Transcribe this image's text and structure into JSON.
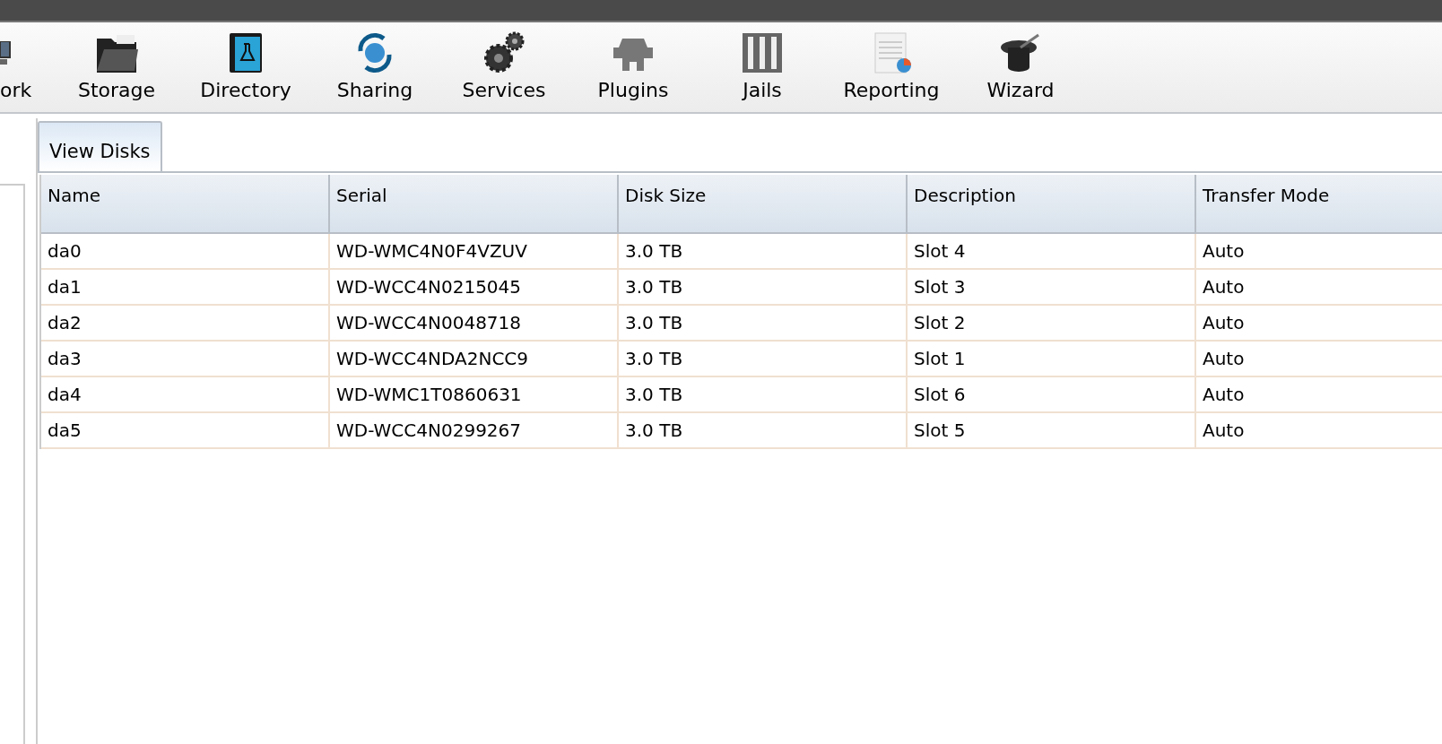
{
  "toolbar": [
    {
      "label": "ork",
      "kind": "network"
    },
    {
      "label": "Storage",
      "kind": "storage"
    },
    {
      "label": "Directory",
      "kind": "directory"
    },
    {
      "label": "Sharing",
      "kind": "sharing"
    },
    {
      "label": "Services",
      "kind": "services"
    },
    {
      "label": "Plugins",
      "kind": "plugins"
    },
    {
      "label": "Jails",
      "kind": "jails"
    },
    {
      "label": "Reporting",
      "kind": "reporting"
    },
    {
      "label": "Wizard",
      "kind": "wizard"
    }
  ],
  "tabs": [
    {
      "label": "View Disks",
      "selected": true
    }
  ],
  "table": {
    "columns": [
      "Name",
      "Serial",
      "Disk Size",
      "Description",
      "Transfer Mode"
    ],
    "rows": [
      [
        "da0",
        "WD-WMC4N0F4VZUV",
        "3.0 TB",
        "Slot 4",
        "Auto"
      ],
      [
        "da1",
        "WD-WCC4N0215045",
        "3.0 TB",
        "Slot 3",
        "Auto"
      ],
      [
        "da2",
        "WD-WCC4N0048718",
        "3.0 TB",
        "Slot 2",
        "Auto"
      ],
      [
        "da3",
        "WD-WCC4NDA2NCC9",
        "3.0 TB",
        "Slot 1",
        "Auto"
      ],
      [
        "da4",
        "WD-WMC1T0860631",
        "3.0 TB",
        "Slot 6",
        "Auto"
      ],
      [
        "da5",
        "WD-WCC4N0299267",
        "3.0 TB",
        "Slot 5",
        "Auto"
      ]
    ]
  }
}
